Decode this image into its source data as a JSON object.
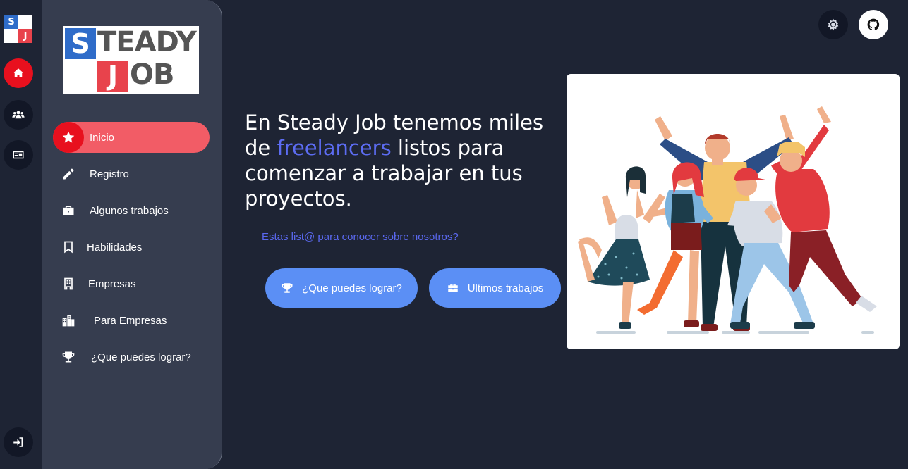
{
  "rail": {
    "logo_letters": [
      "S",
      "J"
    ],
    "items": [
      "home-icon",
      "users-icon",
      "id-card-icon"
    ],
    "bottom": "sign-in-icon"
  },
  "brand": {
    "letter1": "S",
    "word1": "TEADY",
    "letter2": "J",
    "word2": "OB"
  },
  "sidebar": {
    "items": [
      {
        "label": "Inicio",
        "icon": "star-icon"
      },
      {
        "label": "Registro",
        "icon": "pencil-icon"
      },
      {
        "label": "Algunos trabajos",
        "icon": "briefcase-icon"
      },
      {
        "label": "Habilidades",
        "icon": "bookmark-icon"
      },
      {
        "label": "Empresas",
        "icon": "building-icon"
      },
      {
        "label": "Para Empresas",
        "icon": "city-icon"
      },
      {
        "label": "¿Que puedes lograr?",
        "icon": "trophy-icon"
      }
    ]
  },
  "hero": {
    "title_part1": "En Steady Job tenemos miles de",
    "title_highlight": "freelancers",
    "title_part2": "listos para comenzar a trabajar en tus proyectos.",
    "link": "Estas list@ para conocer sobre nosotros?",
    "btn_achieve": "¿Que puedes lograr?",
    "btn_jobs": "Ultimos trabajos"
  },
  "colors": {
    "background": "#1e2434",
    "sidebar": "#363d4f",
    "accent_red": "#e8101e",
    "active_pill": "#f25c66",
    "button_blue": "#5b8ff5",
    "highlight": "#5c6cf2"
  }
}
